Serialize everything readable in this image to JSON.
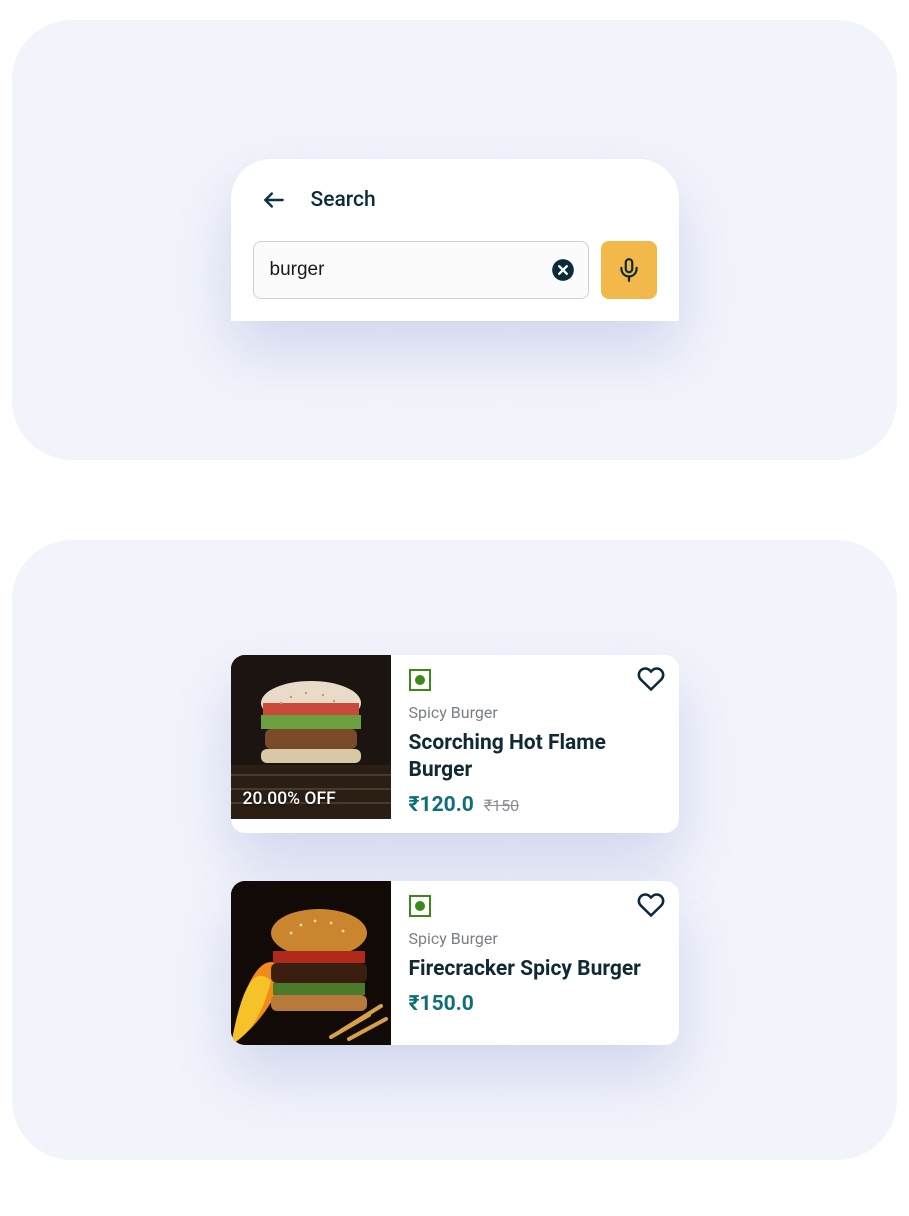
{
  "search": {
    "title": "Search",
    "value": "burger"
  },
  "results": [
    {
      "discount": "20.00% OFF",
      "category": "Spicy Burger",
      "title": "Scorching Hot Flame Burger",
      "price": "₹120.0",
      "original_price": "₹150"
    },
    {
      "discount": "",
      "category": "Spicy Burger",
      "title": "Firecracker Spicy Burger",
      "price": "₹150.0",
      "original_price": ""
    }
  ],
  "colors": {
    "panel_bg": "#f2f4fb",
    "mic_bg": "#f2b94a",
    "price": "#0f6e78",
    "veg": "#3a8a1a"
  }
}
